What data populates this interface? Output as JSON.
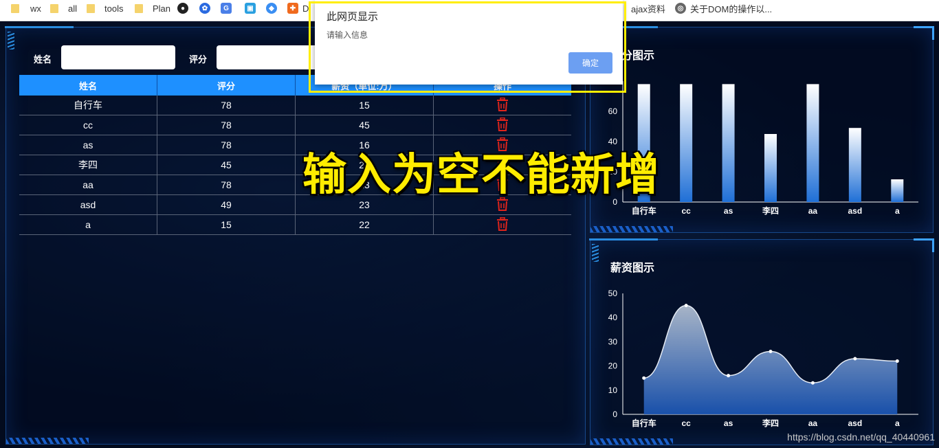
{
  "bookmarks": [
    {
      "label": "wx",
      "icon": "folder-icon"
    },
    {
      "label": "all",
      "icon": "folder-icon"
    },
    {
      "label": "tools",
      "icon": "folder-icon"
    },
    {
      "label": "Plan",
      "icon": "folder-icon"
    },
    {
      "label": "",
      "icon": "github-icon"
    },
    {
      "label": "",
      "icon": "baidu-icon"
    },
    {
      "label": "",
      "icon": "translate-icon"
    },
    {
      "label": "",
      "icon": "image-icon"
    },
    {
      "label": "",
      "icon": "shield-icon"
    },
    {
      "label": "D",
      "icon": "bookmark-icon"
    },
    {
      "label": "ajax资料",
      "icon": "bookmark-icon"
    },
    {
      "label": "关于DOM的操作以...",
      "icon": "globe-icon"
    }
  ],
  "form": {
    "name_label": "姓名",
    "score_label": "评分",
    "name_value": "",
    "score_value": ""
  },
  "table": {
    "headers": [
      "姓名",
      "评分",
      "薪资（单位:万）",
      "操作"
    ],
    "rows": [
      {
        "name": "自行车",
        "score": "78",
        "salary": "15"
      },
      {
        "name": "cc",
        "score": "78",
        "salary": "45"
      },
      {
        "name": "as",
        "score": "78",
        "salary": "16"
      },
      {
        "name": "李四",
        "score": "45",
        "salary": "26"
      },
      {
        "name": "aa",
        "score": "78",
        "salary": "13"
      },
      {
        "name": "asd",
        "score": "49",
        "salary": "23"
      },
      {
        "name": "a",
        "score": "15",
        "salary": "22"
      }
    ]
  },
  "dialog": {
    "title": "此网页显示",
    "message": "请输入信息",
    "ok_label": "确定"
  },
  "overlay_caption": "输入为空不能新增",
  "watermark": "https://blog.csdn.net/qq_40440961",
  "colors": {
    "accent": "#1e90ff",
    "highlight": "#ffec00",
    "delete": "#e0241b"
  },
  "chart_data": [
    {
      "type": "bar",
      "title": "评分图示",
      "categories": [
        "自行车",
        "cc",
        "as",
        "李四",
        "aa",
        "asd",
        "a"
      ],
      "values": [
        78,
        78,
        78,
        45,
        78,
        49,
        15
      ],
      "yticks": [
        0,
        20,
        40,
        60
      ],
      "ylim": [
        0,
        80
      ]
    },
    {
      "type": "area",
      "title": "薪资图示",
      "categories": [
        "自行车",
        "cc",
        "as",
        "李四",
        "aa",
        "asd",
        "a"
      ],
      "values": [
        15,
        45,
        16,
        26,
        13,
        23,
        22
      ],
      "yticks": [
        0,
        10,
        20,
        30,
        40,
        50
      ],
      "ylim": [
        0,
        50
      ]
    }
  ]
}
